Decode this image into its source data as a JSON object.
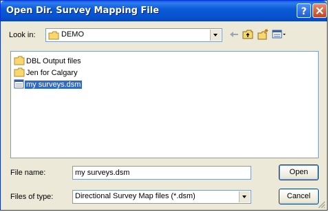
{
  "window": {
    "title": "Open Dir. Survey Mapping File"
  },
  "look_in": {
    "label": "Look in:",
    "value": "DEMO"
  },
  "toolbar": {
    "icons": [
      "back-arrow-icon",
      "up-one-level-icon",
      "new-folder-icon",
      "view-menu-icon"
    ]
  },
  "file_list": {
    "items": [
      {
        "name": "DBL Output files",
        "type": "folder",
        "selected": false
      },
      {
        "name": "Jen for Calgary",
        "type": "folder",
        "selected": false
      },
      {
        "name": "my surveys.dsm",
        "type": "file",
        "selected": true
      }
    ]
  },
  "file_name": {
    "label": "File name:",
    "value": "my surveys.dsm"
  },
  "files_of_type": {
    "label": "Files of type:",
    "value": "Directional Survey Map files (*.dsm)"
  },
  "buttons": {
    "open": "Open",
    "cancel": "Cancel"
  },
  "colors": {
    "title_bar": "#0752cf",
    "selection": "#316ac5",
    "dialog_bg": "#ece9d8"
  }
}
